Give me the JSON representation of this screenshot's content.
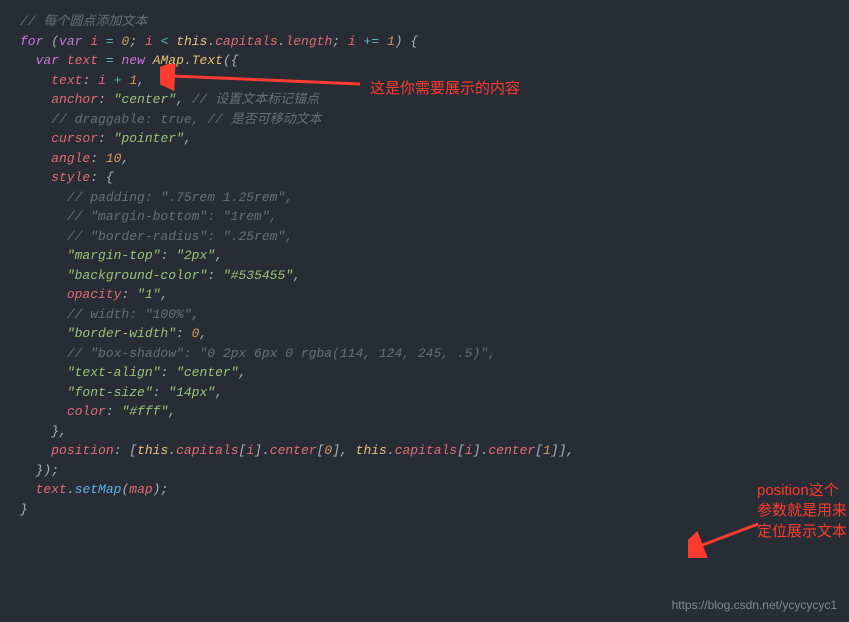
{
  "code": {
    "c1": "// 每个圆点添加文本",
    "for_kw": "for",
    "var_kw": "var",
    "i": "i",
    "eq": "=",
    "zero": "0",
    "semi": ";",
    "lt": "<",
    "this": "this",
    "capitals": "capitals",
    "length": "length",
    "pluseq": "+=",
    "one": "1",
    "lparen": "(",
    "rparen": ")",
    "lbrace": "{",
    "rbrace": "}",
    "text_var": "text",
    "new_kw": "new",
    "amap": "AMap",
    "text_cls": "Text",
    "text_prop": "text",
    "colon": ":",
    "plus": "+",
    "comma": ",",
    "anchor": "anchor",
    "center_str": "\"center\"",
    "c2": "// 设置文本标记锚点",
    "c3": "// draggable: true, // 是否可移动文本",
    "cursor": "cursor",
    "pointer_str": "\"pointer\"",
    "angle": "angle",
    "ten": "10",
    "style": "style",
    "c4": "// padding: \".75rem 1.25rem\",",
    "c5": "// \"margin-bottom\": \"1rem\",",
    "c6": "// \"border-radius\": \".25rem\",",
    "mtop": "\"margin-top\"",
    "mtop_v": "\"2px\"",
    "bgc": "\"background-color\"",
    "bgc_v": "\"#535455\"",
    "opacity": "opacity",
    "opacity_v": "\"1\"",
    "c7": "// width: \"100%\",",
    "bw": "\"border-width\"",
    "bw_v": "0",
    "c8": "// \"box-shadow\": \"0 2px 6px 0 rgba(114, 124, 245, .5)\",",
    "ta": "\"text-align\"",
    "ta_v": "\"center\"",
    "fs": "\"font-size\"",
    "fs_v": "\"14px\"",
    "color": "color",
    "color_v": "\"#fff\"",
    "position": "position",
    "lbracket": "[",
    "rbracket": "]",
    "center_prop": "center",
    "dot": ".",
    "setMap": "setMap",
    "map": "map"
  },
  "annotations": {
    "top": "这是你需要展示的内容",
    "right": "position这个参数就是用来定位展示文本"
  },
  "watermark": "https://blog.csdn.net/ycycycyc1"
}
